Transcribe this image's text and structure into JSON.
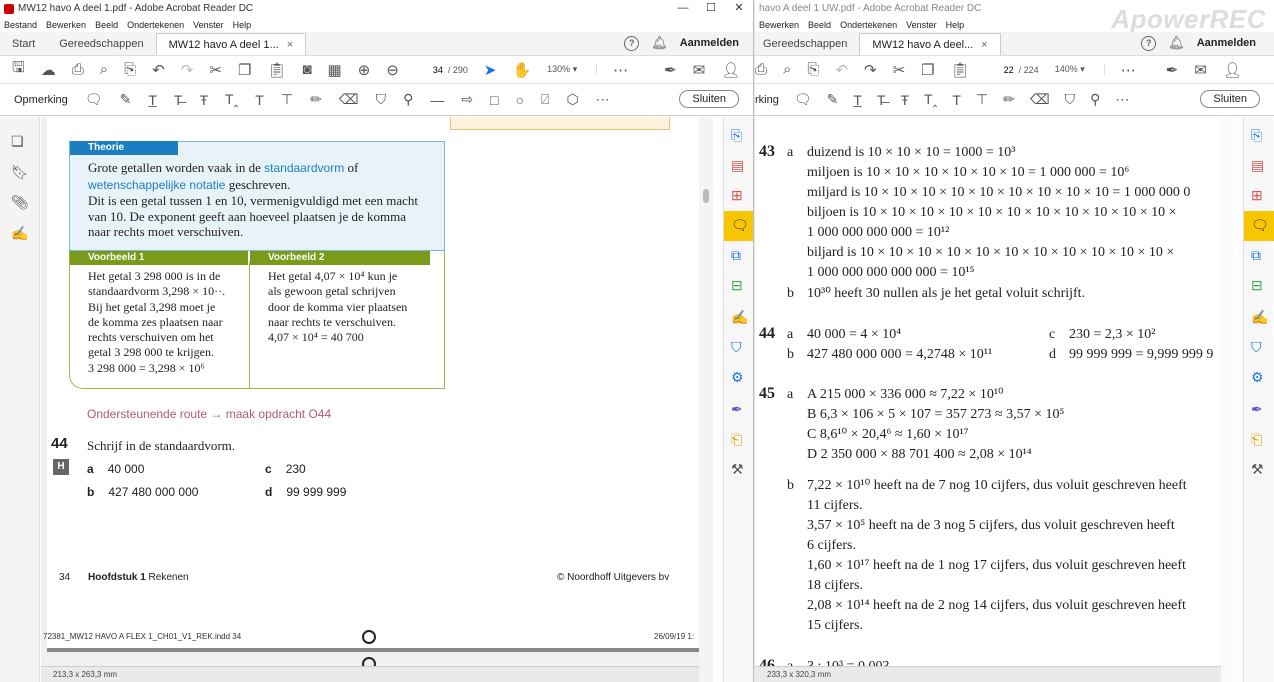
{
  "left_window": {
    "title": "MW12 havo A deel 1.pdf - Adobe Acrobat Reader DC",
    "window_controls": {
      "minimize": "—",
      "maximize": "☐",
      "close": "✕"
    },
    "menu": [
      "Bestand",
      "Bewerken",
      "Beeld",
      "Ondertekenen",
      "Venster",
      "Help"
    ],
    "tabs": {
      "start": "Start",
      "tools": "Gereedschappen",
      "document": "MW12 havo A deel 1...",
      "close": "×"
    },
    "sign_in": "Aanmelden",
    "page_current": "34",
    "page_total": "/ 290",
    "zoom": "130%",
    "annotate_label": "Opmerking",
    "close_button": "Sluiten",
    "page_size": "213,3 x 263,3 mm",
    "page": {
      "theory_title": "Theorie",
      "theory_line1_pre": "Grote getallen worden vaak in de ",
      "theory_hl1": "standaardvorm",
      "theory_line1_post": " of",
      "theory_hl2": "wetenschappelijke notatie",
      "theory_line2_post": " geschreven.",
      "theory_line3": "Dit is een getal tussen 1 en 10, vermenigvuldigd met een macht",
      "theory_line4": "van 10. De exponent geeft aan hoeveel plaatsen je de komma",
      "theory_line5": "naar rechts moet verschuiven.",
      "example1_title": "Voorbeeld 1",
      "example1_lines": [
        "Het getal  3 298 000 is in de",
        "standaardvorm 3,298 × 10··.",
        "Bij het getal 3,298 moet je",
        "de komma zes plaatsen naar",
        "rechts verschuiven om het",
        "getal 3 298 000 te krijgen.",
        "3 298 000 = 3,298 × 10⁶"
      ],
      "example2_title": "Voorbeeld 2",
      "example2_lines": [
        "Het getal  4,07 × 10⁴ kun je",
        "als gewoon getal schrijven",
        "door de komma vier plaatsen",
        "naar rechts te verschuiven.",
        "4,07 × 10⁴ =  40 700"
      ],
      "route": "Ondersteunende route → maak opdracht O44",
      "exercise_number": "44",
      "exercise_question": "Schrijf in de standaardvorm.",
      "badge": "H",
      "items": [
        {
          "letter": "a",
          "value": "40 000"
        },
        {
          "letter": "c",
          "value": "230"
        },
        {
          "letter": "b",
          "value": "427 480 000 000"
        },
        {
          "letter": "d",
          "value": "99 999 999"
        }
      ],
      "footer_page": "34",
      "footer_chapter_bold": "Hoofdstuk 1",
      "footer_chapter": " Rekenen",
      "footer_publisher": "© Noordhoff Uitgevers bv",
      "slug_file": "72381_MW12 HAVO A FLEX 1_CH01_V1_REK.indd   34",
      "slug_date": "26/09/19   1:"
    }
  },
  "right_window": {
    "title": "havo A deel 1 UW.pdf - Adobe Acrobat Reader DC",
    "watermark": "ApowerREC",
    "menu": [
      "Bewerken",
      "Beeld",
      "Ondertekenen",
      "Venster",
      "Help"
    ],
    "tabs": {
      "tools": "Gereedschappen",
      "document": "MW12 havo A deel...",
      "close": "×"
    },
    "sign_in": "Aanmelden",
    "page_current": "22",
    "page_total": "/ 224",
    "zoom": "140%",
    "annotate_label": "rking",
    "close_button": "Sluiten",
    "page_size": "233,3 x 320,3 mm",
    "solutions": {
      "s43_num": "43",
      "s43a": [
        "duizend is 10 × 10 × 10 = 1000 = 10³",
        "miljoen is 10 × 10 × 10 × 10 × 10 × 10 = 1 000 000 = 10⁶",
        "miljard is 10 × 10 × 10 × 10 × 10 × 10 × 10 × 10 × 10 = 1 000 000 0",
        "biljoen is 10 × 10 × 10 × 10 × 10 × 10 × 10 × 10 × 10 × 10 × 10 ×",
        "1 000 000 000 000 = 10¹²",
        "biljard is 10 × 10 × 10 × 10 × 10 × 10 × 10 × 10 × 10 × 10 × 10 ×",
        "1 000 000 000 000 000 = 10¹⁵"
      ],
      "s43b": "10³⁰ heeft 30 nullen als je het getal voluit schrijft.",
      "s44_num": "44",
      "s44a": "40 000 = 4 × 10⁴",
      "s44b": "427 480 000 000 = 4,2748 × 10¹¹",
      "s44c": "230 = 2,3 × 10²",
      "s44d": "99 999 999 = 9,999 999 9",
      "s45_num": "45",
      "s45a": [
        "A  215 000 × 336 000 ≈ 7,22 × 10¹⁰",
        "B  6,3 × 106 × 5 × 107 = 357 273 ≈ 3,57 × 10⁵",
        "C  8,6¹⁰ × 20,4⁶ ≈ 1,60 × 10¹⁷",
        "D  2 350 000 × 88 701 400 ≈ 2,08 × 10¹⁴"
      ],
      "s45b": [
        "7,22 × 10¹⁰ heeft na de 7 nog 10 cijfers, dus voluit geschreven heeft",
        "11 cijfers.",
        "3,57 × 10⁵ heeft na de 3 nog 5 cijfers, dus voluit geschreven heeft",
        "6 cijfers.",
        "1,60 × 10¹⁷ heeft na de 1 nog 17 cijfers, dus voluit geschreven heeft",
        "18 cijfers.",
        "2,08 × 10¹⁴ heeft na de 2 nog 14 cijfers, dus voluit geschreven heeft",
        "15 cijfers."
      ],
      "s46_num": "46",
      "s46a": "3 : 10³ = 0,003"
    }
  },
  "labels": {
    "a": "a",
    "b": "b",
    "c": "c",
    "d": "d"
  }
}
